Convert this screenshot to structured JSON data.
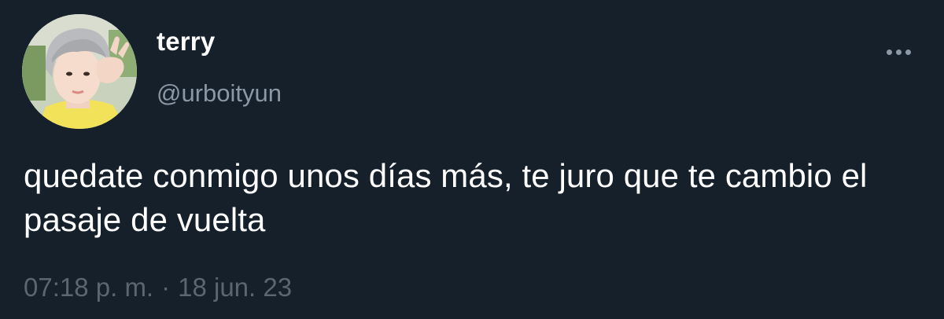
{
  "user": {
    "display_name": "terry",
    "handle": "@urboityun",
    "avatar_alt": "avatar"
  },
  "tweet": {
    "text": "quedate conmigo unos días más, te juro que te cambio el pasaje de vuelta",
    "time": "07:18 p. m.",
    "separator": "·",
    "date": "18 jun. 23"
  },
  "icons": {
    "more": "more-horizontal-icon"
  },
  "colors": {
    "background": "#15202b",
    "primary_text": "#ffffff",
    "secondary_text": "#8b98a5",
    "meta_text": "#5b6671"
  }
}
